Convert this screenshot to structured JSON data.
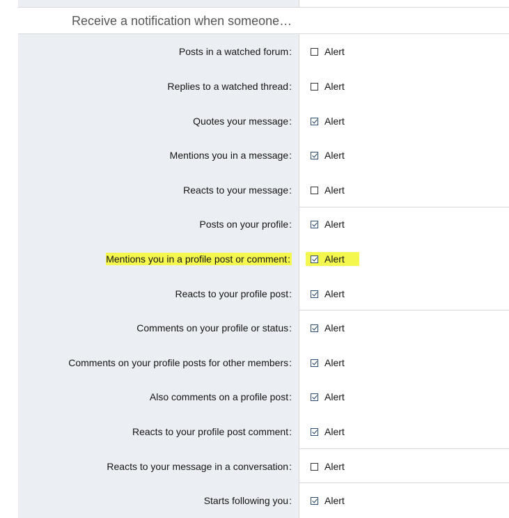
{
  "section": {
    "title": "Receive a notification when someone…"
  },
  "rows": [
    {
      "label": "Posts in a watched forum",
      "option": "Alert",
      "checked": false,
      "highlight": false
    },
    {
      "label": "Replies to a watched thread",
      "option": "Alert",
      "checked": false,
      "highlight": false
    },
    {
      "label": "Quotes your message",
      "option": "Alert",
      "checked": true,
      "highlight": false
    },
    {
      "label": "Mentions you in a message",
      "option": "Alert",
      "checked": true,
      "highlight": false
    },
    {
      "label": "Reacts to your message",
      "option": "Alert",
      "checked": false,
      "highlight": false
    },
    {
      "label": "Posts on your profile",
      "option": "Alert",
      "checked": true,
      "highlight": false
    },
    {
      "label": "Mentions you in a profile post or comment",
      "option": "Alert",
      "checked": true,
      "highlight": true
    },
    {
      "label": "Reacts to your profile post",
      "option": "Alert",
      "checked": true,
      "highlight": false
    },
    {
      "label": "Comments on your profile or status",
      "option": "Alert",
      "checked": true,
      "highlight": false
    },
    {
      "label": "Comments on your profile posts for other members",
      "option": "Alert",
      "checked": true,
      "highlight": false
    },
    {
      "label": "Also comments on a profile post",
      "option": "Alert",
      "checked": true,
      "highlight": false
    },
    {
      "label": "Reacts to your profile post comment",
      "option": "Alert",
      "checked": true,
      "highlight": false
    },
    {
      "label": "Reacts to your message in a conversation",
      "option": "Alert",
      "checked": false,
      "highlight": false
    },
    {
      "label": "Starts following you",
      "option": "Alert",
      "checked": true,
      "highlight": false
    }
  ],
  "colors": {
    "label_bg": "#ebeef2",
    "highlight": "#f4f74d",
    "border": "#d8d8d8"
  }
}
